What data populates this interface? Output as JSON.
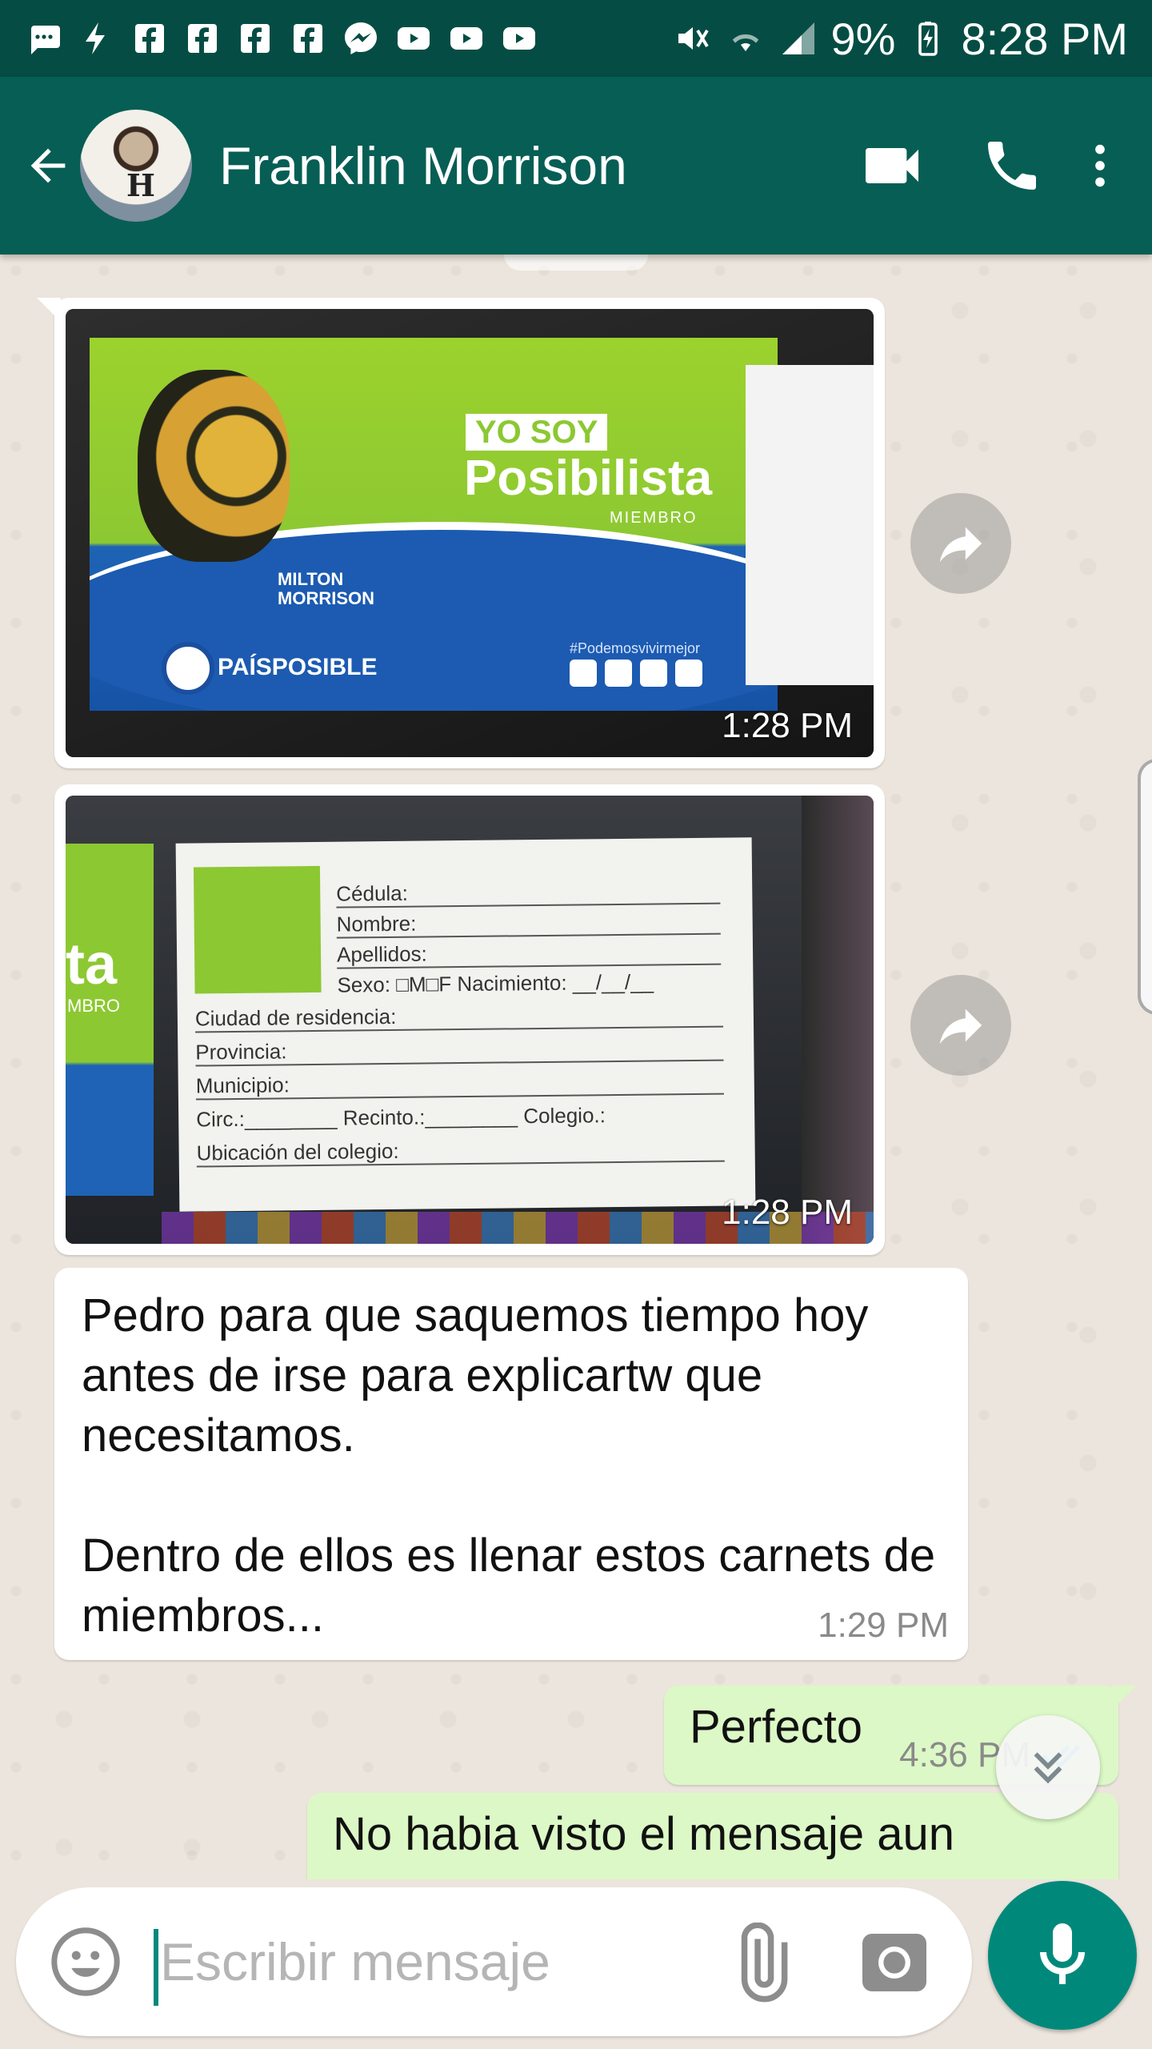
{
  "status_bar": {
    "battery": "9%",
    "time": "8:28 PM",
    "left_icons": [
      "messages-icon",
      "flash-icon",
      "facebook-icon",
      "facebook-icon",
      "facebook-icon",
      "facebook-icon",
      "messenger-icon",
      "youtube-icon",
      "youtube-icon",
      "youtube-icon"
    ],
    "right_icons": [
      "mute-icon",
      "wifi-icon",
      "signal-icon",
      "battery-charging-icon"
    ]
  },
  "header": {
    "contact_name": "Franklin Morrison",
    "avatar_letter": "H",
    "actions": [
      "video-call-icon",
      "phone-call-icon",
      "more-options-icon"
    ]
  },
  "messages": [
    {
      "type": "image",
      "direction": "in",
      "time": "1:28 PM",
      "image": {
        "yo_soy": "YO SOY",
        "title": "Posibilista",
        "subtitle": "MIEMBRO",
        "name": "MILTON MORRISON",
        "brand": "PAÍSPOSIBLE",
        "hashtag": "#Podemosvivirmejor"
      }
    },
    {
      "type": "image",
      "direction": "in",
      "time": "1:28 PM",
      "image": {
        "side_big": "ta",
        "side_small": "MBRO",
        "fields": {
          "cedula": "Cédula:",
          "nombre": "Nombre:",
          "apellidos": "Apellidos:",
          "sexo": "Sexo: □M□F  Nacimiento: __/__/__",
          "ciudad": "Ciudad de residencia:",
          "provincia": "Provincia:",
          "municipio": "Municipio:",
          "circ": "Circ.:________ Recinto.:________ Colegio.:",
          "ubicacion": "Ubicación del colegio:"
        }
      }
    },
    {
      "type": "text",
      "direction": "in",
      "text": "Pedro para que saquemos tiempo hoy antes de irse para explicartw que necesitamos.\n\nDentro de ellos es llenar estos carnets de miembros...",
      "time": "1:29 PM"
    },
    {
      "type": "text",
      "direction": "out",
      "text": "Perfecto",
      "time": "4:36 PM"
    },
    {
      "type": "text",
      "direction": "out",
      "text": "No habia visto el mensaje aun"
    }
  ],
  "composer": {
    "placeholder": "Escribir mensaje",
    "icons": [
      "emoji-icon",
      "attach-icon",
      "camera-icon",
      "mic-icon"
    ]
  },
  "colors": {
    "header": "#075e54",
    "status_bar": "#054d44",
    "accent": "#00897b",
    "outgoing_bubble": "#dcf8c6",
    "incoming_bubble": "#ffffff",
    "chat_background": "#ece5dd"
  }
}
